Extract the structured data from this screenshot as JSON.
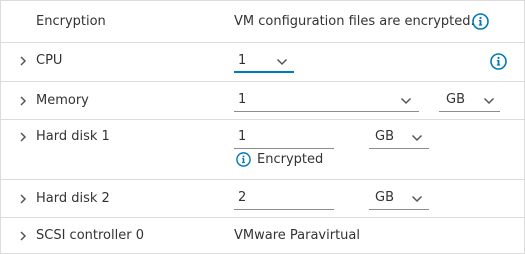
{
  "accent_color": "#0079b8",
  "rows": {
    "encryption": {
      "label": "Encryption",
      "value": "VM configuration files are encrypted.",
      "icon": "info-icon"
    },
    "cpu": {
      "label": "CPU",
      "value": "1",
      "icon": "info-icon"
    },
    "memory": {
      "label": "Memory",
      "value": "1",
      "unit": "GB"
    },
    "hard_disk_1": {
      "label": "Hard disk 1",
      "value": "1",
      "unit": "GB",
      "note": "Encrypted",
      "note_icon": "info-icon"
    },
    "hard_disk_2": {
      "label": "Hard disk 2",
      "value": "2",
      "unit": "GB"
    },
    "scsi_controller_0": {
      "label": "SCSI controller 0",
      "value": "VMware Paravirtual"
    }
  }
}
